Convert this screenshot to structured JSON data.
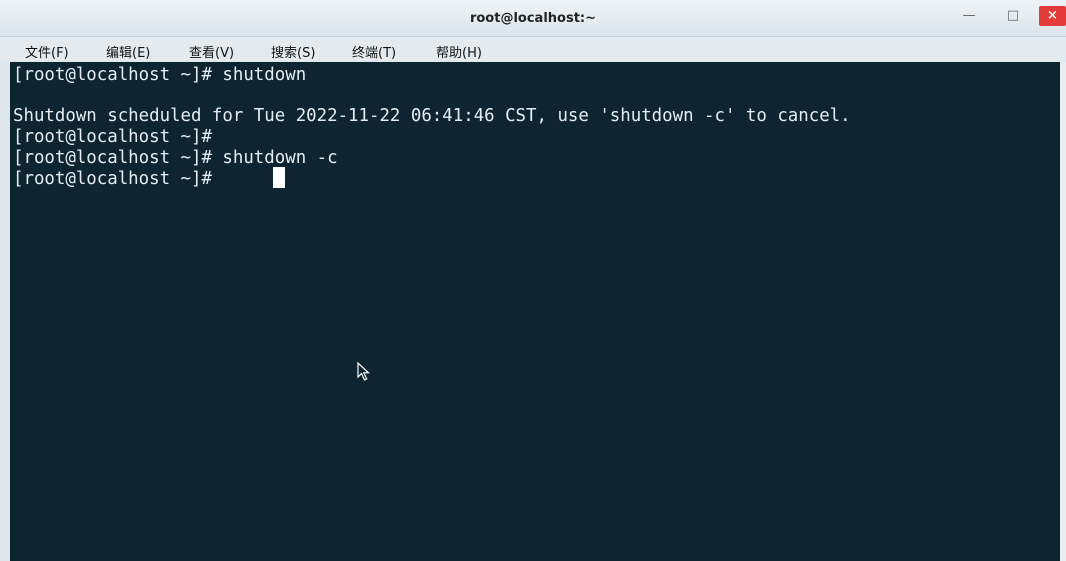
{
  "window": {
    "title": "root@localhost:~",
    "controls": {
      "minimize": "—",
      "maximize": "□",
      "close": "×"
    }
  },
  "menu": {
    "items": [
      "文件(F)",
      "编辑(E)",
      "查看(V)",
      "搜索(S)",
      "终端(T)",
      "帮助(H)"
    ]
  },
  "terminal": {
    "lines": [
      "[root@localhost ~]# shutdown",
      "",
      "Shutdown scheduled for Tue 2022-11-22 06:41:46 CST, use 'shutdown -c' to cancel.",
      "[root@localhost ~]#",
      "[root@localhost ~]# shutdown -c",
      "[root@localhost ~]# "
    ],
    "colors": {
      "background": "#0e2430",
      "text": "#e6edf2"
    }
  }
}
